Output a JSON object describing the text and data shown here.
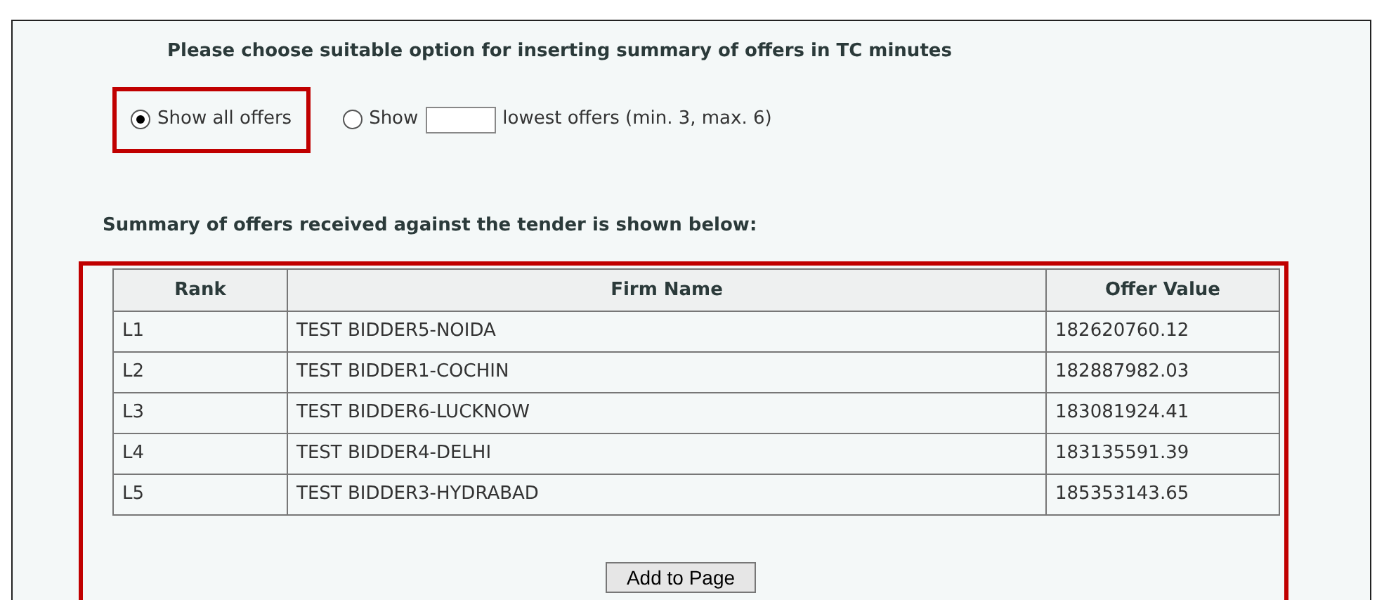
{
  "heading": "Please choose suitable option for inserting summary of offers in TC minutes",
  "options": [
    {
      "kind": "plain",
      "label": "Show all offers",
      "selected": true,
      "highlighted": true
    },
    {
      "kind": "count",
      "label": "Show",
      "suffix": "lowest offers (min. 3, max. 6)",
      "selected": false,
      "highlighted": false
    }
  ],
  "summary_title": "Summary of offers received against the tender is shown below:",
  "table": {
    "highlighted": true,
    "columns": [
      "Rank",
      "Firm Name",
      "Offer Value"
    ],
    "rows": [
      [
        "L1",
        "TEST BIDDER5-NOIDA",
        "182620760.12"
      ],
      [
        "L2",
        "TEST BIDDER1-COCHIN",
        "182887982.03"
      ],
      [
        "L3",
        "TEST BIDDER6-LUCKNOW",
        "183081924.41"
      ],
      [
        "L4",
        "TEST BIDDER4-DELHI",
        "183135591.39"
      ],
      [
        "L5",
        "TEST BIDDER3-HYDRABAD",
        "185353143.65"
      ]
    ]
  },
  "button": "Add to Page"
}
